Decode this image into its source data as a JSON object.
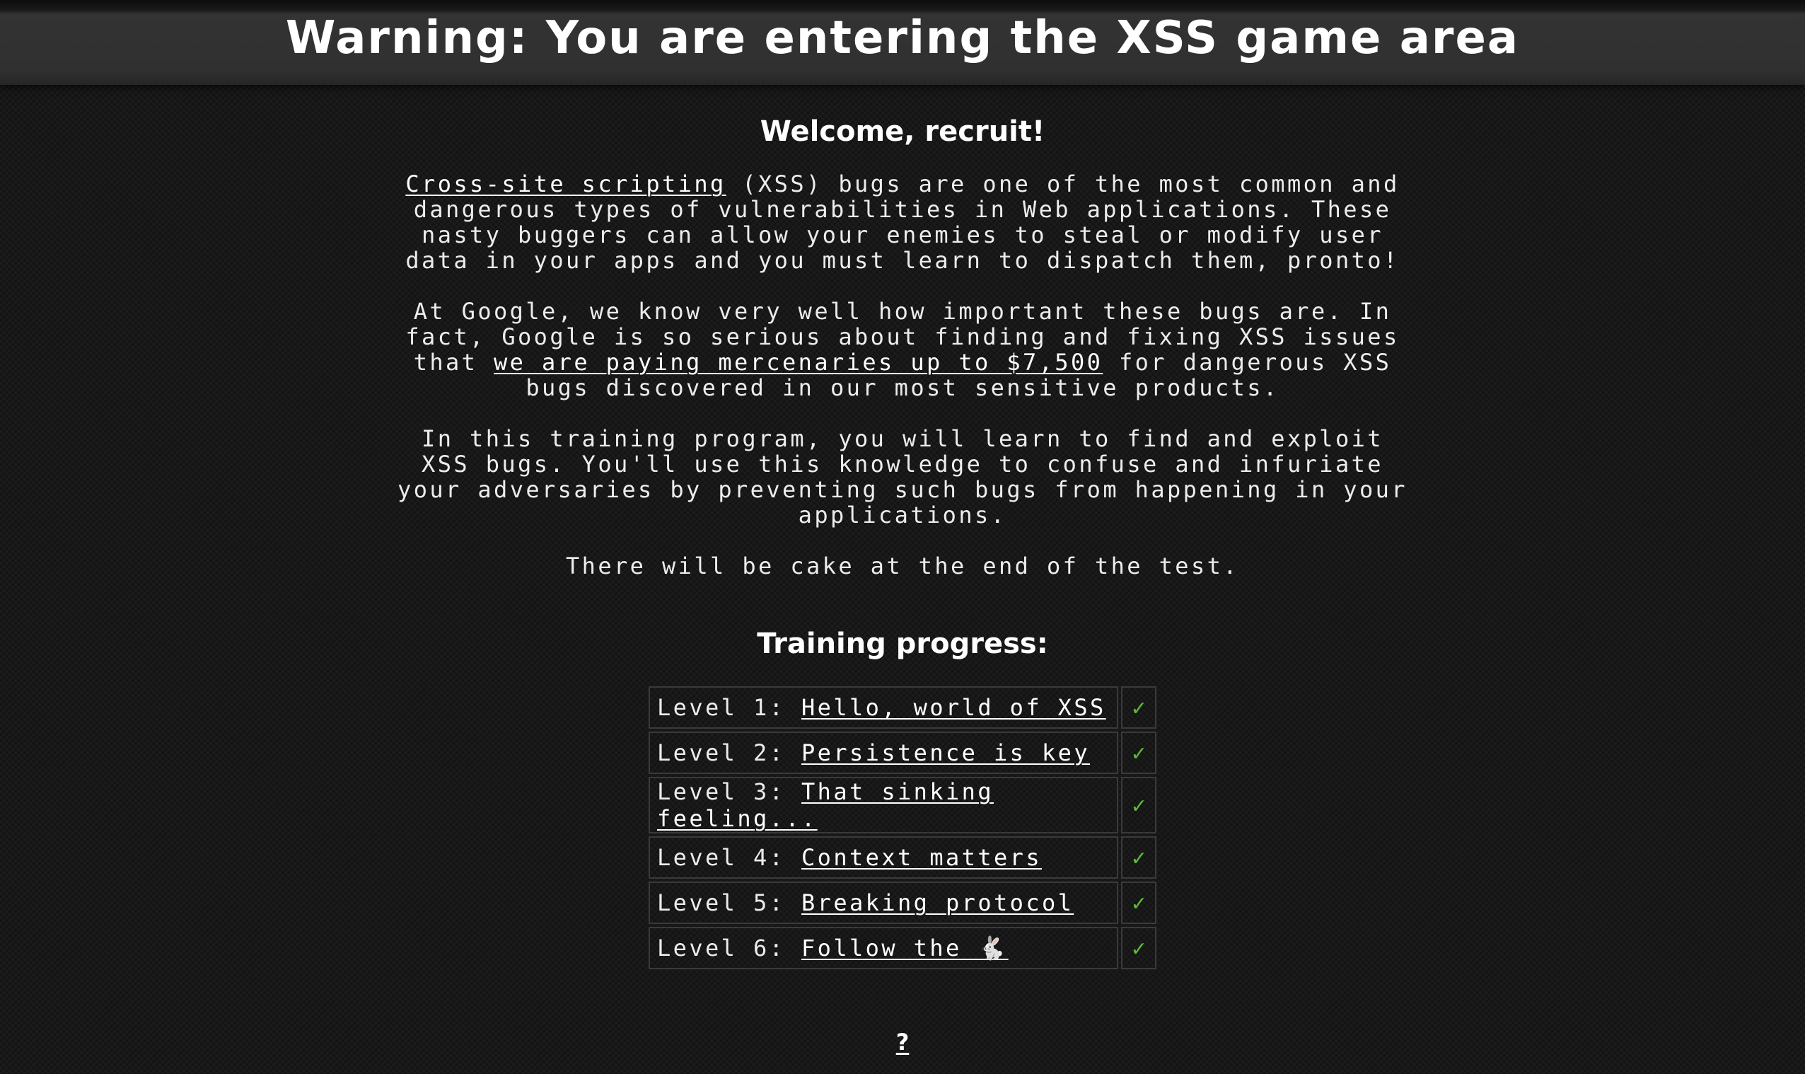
{
  "header": {
    "title": "Warning: You are entering the XSS game area"
  },
  "welcome": {
    "heading": "Welcome, recruit!",
    "p1_link": "Cross-site scripting",
    "p1_text": " (XSS) bugs are one of the most common and dangerous types of vulnerabilities in Web applications. These nasty buggers can allow your enemies to steal or modify user data in your apps and you must learn to dispatch them, pronto!",
    "p2_text_a": "At Google, we know very well how important these bugs are. In fact, Google is so serious about finding and fixing XSS issues that ",
    "p2_link": "we are paying mercenaries up to $7,500",
    "p2_text_b": " for dangerous XSS bugs discovered in our most sensitive products.",
    "p3_text": "In this training program, you will learn to find and exploit XSS bugs. You'll use this knowledge to confuse and infuriate your adversaries by preventing such bugs from happening in your applications.",
    "p4_text": "There will be cake at the end of the test."
  },
  "progress": {
    "heading": "Training progress:",
    "check_symbol": "✓",
    "check_color": "#5dbb3a",
    "levels": [
      {
        "prefix": "Level 1: ",
        "title": "Hello, world of XSS",
        "completed": true
      },
      {
        "prefix": "Level 2: ",
        "title": "Persistence is key",
        "completed": true
      },
      {
        "prefix": "Level 3: ",
        "title": "That sinking feeling...",
        "completed": true
      },
      {
        "prefix": "Level 4: ",
        "title": "Context matters",
        "completed": true
      },
      {
        "prefix": "Level 5: ",
        "title": "Breaking protocol",
        "completed": true
      },
      {
        "prefix": "Level 6: ",
        "title": "Follow the 🐇",
        "completed": true
      }
    ]
  },
  "footer": {
    "help_link": "?"
  }
}
